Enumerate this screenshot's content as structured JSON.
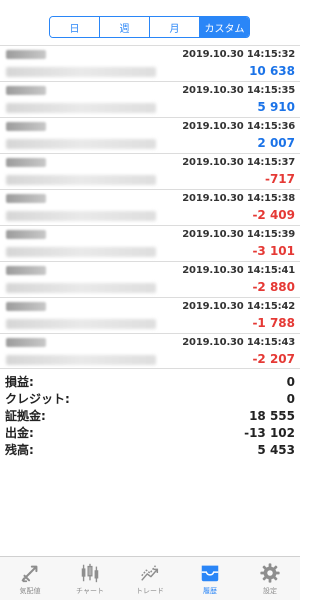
{
  "segments": [
    {
      "label": "日",
      "active": false
    },
    {
      "label": "週",
      "active": false
    },
    {
      "label": "月",
      "active": false
    },
    {
      "label": "カスタム",
      "active": true
    }
  ],
  "deals": [
    {
      "time": "2019.10.30 14:15:32",
      "amount": "10 638",
      "type": "positive"
    },
    {
      "time": "2019.10.30 14:15:35",
      "amount": "5 910",
      "type": "positive"
    },
    {
      "time": "2019.10.30 14:15:36",
      "amount": "2 007",
      "type": "positive"
    },
    {
      "time": "2019.10.30 14:15:37",
      "amount": "-717",
      "type": "negative"
    },
    {
      "time": "2019.10.30 14:15:38",
      "amount": "-2 409",
      "type": "negative"
    },
    {
      "time": "2019.10.30 14:15:39",
      "amount": "-3 101",
      "type": "negative"
    },
    {
      "time": "2019.10.30 14:15:41",
      "amount": "-2 880",
      "type": "negative"
    },
    {
      "time": "2019.10.30 14:15:42",
      "amount": "-1 788",
      "type": "negative"
    },
    {
      "time": "2019.10.30 14:15:43",
      "amount": "-2 207",
      "type": "negative"
    }
  ],
  "summary": [
    {
      "label": "損益:",
      "value": "0"
    },
    {
      "label": "クレジット:",
      "value": "0"
    },
    {
      "label": "証拠金:",
      "value": "18 555"
    },
    {
      "label": "出金:",
      "value": "-13 102"
    },
    {
      "label": "残高:",
      "value": "5 453"
    }
  ],
  "tabs": [
    {
      "label": "気配値",
      "icon": "quotes-icon",
      "active": false
    },
    {
      "label": "チャート",
      "icon": "chart-icon",
      "active": false
    },
    {
      "label": "トレード",
      "icon": "trade-icon",
      "active": false
    },
    {
      "label": "履歴",
      "icon": "history-icon",
      "active": true
    },
    {
      "label": "設定",
      "icon": "settings-icon",
      "active": false
    }
  ],
  "colors": {
    "accent": "#2a86f7",
    "positive": "#1b73e8",
    "negative": "#e53935"
  }
}
